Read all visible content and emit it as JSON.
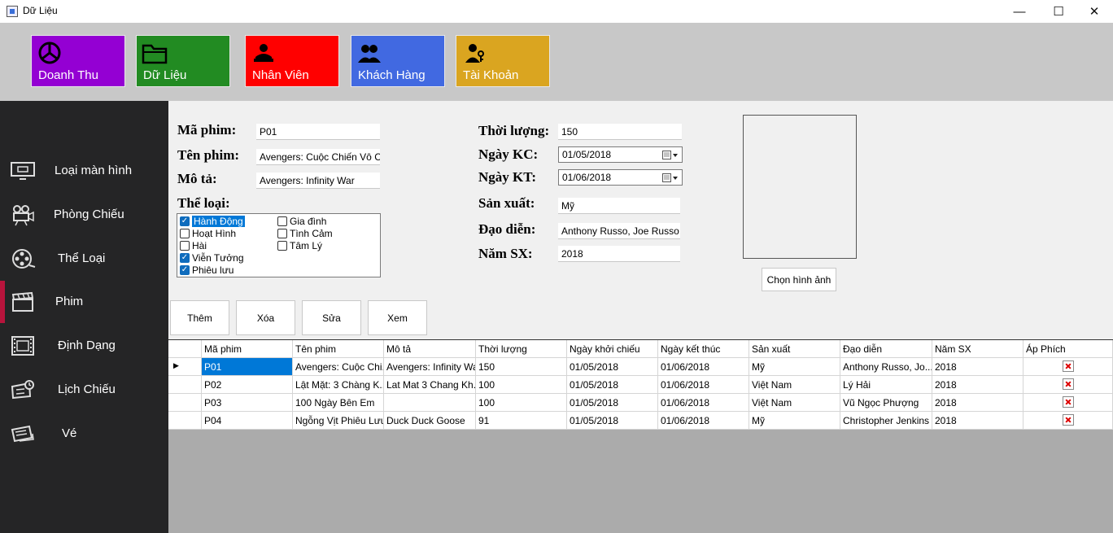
{
  "window": {
    "title": "Dữ Liệu",
    "minimize": "—",
    "maximize": "☐",
    "close": "✕"
  },
  "tiles": [
    {
      "label": "Doanh Thu",
      "color": "#9400d3",
      "icon": "chart-pie-icon"
    },
    {
      "label": "Dữ Liệu",
      "color": "#228b22",
      "icon": "folder-icon"
    },
    {
      "label": "Nhân Viên",
      "color": "#ff0000",
      "icon": "employee-icon"
    },
    {
      "label": "Khách Hàng",
      "color": "#4169e1",
      "icon": "customers-icon"
    },
    {
      "label": "Tài Khoản",
      "color": "#daa520",
      "icon": "account-icon"
    }
  ],
  "sidebar": {
    "items": [
      {
        "label": "Loại màn hình",
        "icon": "monitor-icon"
      },
      {
        "label": "Phòng Chiếu",
        "icon": "projector-icon"
      },
      {
        "label": "Thể Loại",
        "icon": "film-reel-icon"
      },
      {
        "label": "Phim",
        "icon": "clapperboard-icon"
      },
      {
        "label": "Định Dạng",
        "icon": "film-format-icon"
      },
      {
        "label": "Lịch Chiếu",
        "icon": "schedule-icon"
      },
      {
        "label": "Vé",
        "icon": "ticket-icon"
      }
    ]
  },
  "form": {
    "ma_phim_label": "Mã phim:",
    "ma_phim_value": "P01",
    "ten_phim_label": "Tên phim:",
    "ten_phim_value": "Avengers: Cuộc Chiến Vô Cực",
    "mo_ta_label": "Mô tả:",
    "mo_ta_value": "Avengers: Infinity War",
    "the_loai_label": "Thể loại:",
    "genres": [
      {
        "label": "Hành Động",
        "checked": true
      },
      {
        "label": "Hoạt Hình",
        "checked": false
      },
      {
        "label": "Hài",
        "checked": false
      },
      {
        "label": "Viễn Tưởng",
        "checked": true
      },
      {
        "label": "Phiêu lưu",
        "checked": true
      },
      {
        "label": "Gia đình",
        "checked": false
      },
      {
        "label": "Tình Cảm",
        "checked": false
      },
      {
        "label": "Tâm Lý",
        "checked": false
      }
    ],
    "thoi_luong_label": "Thời lượng:",
    "thoi_luong_value": "150",
    "ngay_kc_label": "Ngày KC:",
    "ngay_kc_value": "01/05/2018",
    "ngay_kt_label": "Ngày KT:",
    "ngay_kt_value": "01/06/2018",
    "san_xuat_label": "Sản xuất:",
    "san_xuat_value": "Mỹ",
    "dao_dien_label": "Đạo diễn:",
    "dao_dien_value": "Anthony Russo,  Joe Russo",
    "nam_sx_label": "Năm SX:",
    "nam_sx_value": "2018",
    "choose_image_label": "Chọn hình ảnh"
  },
  "actions": {
    "add": "Thêm",
    "delete": "Xóa",
    "edit": "Sửa",
    "view": "Xem"
  },
  "grid": {
    "columns": [
      "Mã phim",
      "Tên phim",
      "Mô tả",
      "Thời lượng",
      "Ngày khởi chiếu",
      "Ngày kết thúc",
      "Sản xuất",
      "Đạo diễn",
      "Năm SX",
      "Áp Phích"
    ],
    "current_row_marker": "▶",
    "rows": [
      [
        "P01",
        "Avengers: Cuộc Chi...",
        "Avengers: Infinity War",
        "150",
        "01/05/2018",
        "01/06/2018",
        "Mỹ",
        "Anthony Russo,  Jo...",
        "2018"
      ],
      [
        "P02",
        "Lật Mặt: 3 Chàng K...",
        "Lat Mat 3 Chang Kh...",
        "100",
        "01/05/2018",
        "01/06/2018",
        "Việt Nam",
        "Lý Hải",
        "2018"
      ],
      [
        "P03",
        "100 Ngày Bên Em",
        "",
        "100",
        "01/05/2018",
        "01/06/2018",
        "Việt Nam",
        "Vũ Ngọc Phượng",
        "2018"
      ],
      [
        "P04",
        "Ngỗng Vịt Phiêu Lưu...",
        "Duck Duck Goose",
        "91",
        "01/05/2018",
        "01/06/2018",
        "Mỹ",
        "Christopher Jenkins",
        "2018"
      ]
    ]
  }
}
